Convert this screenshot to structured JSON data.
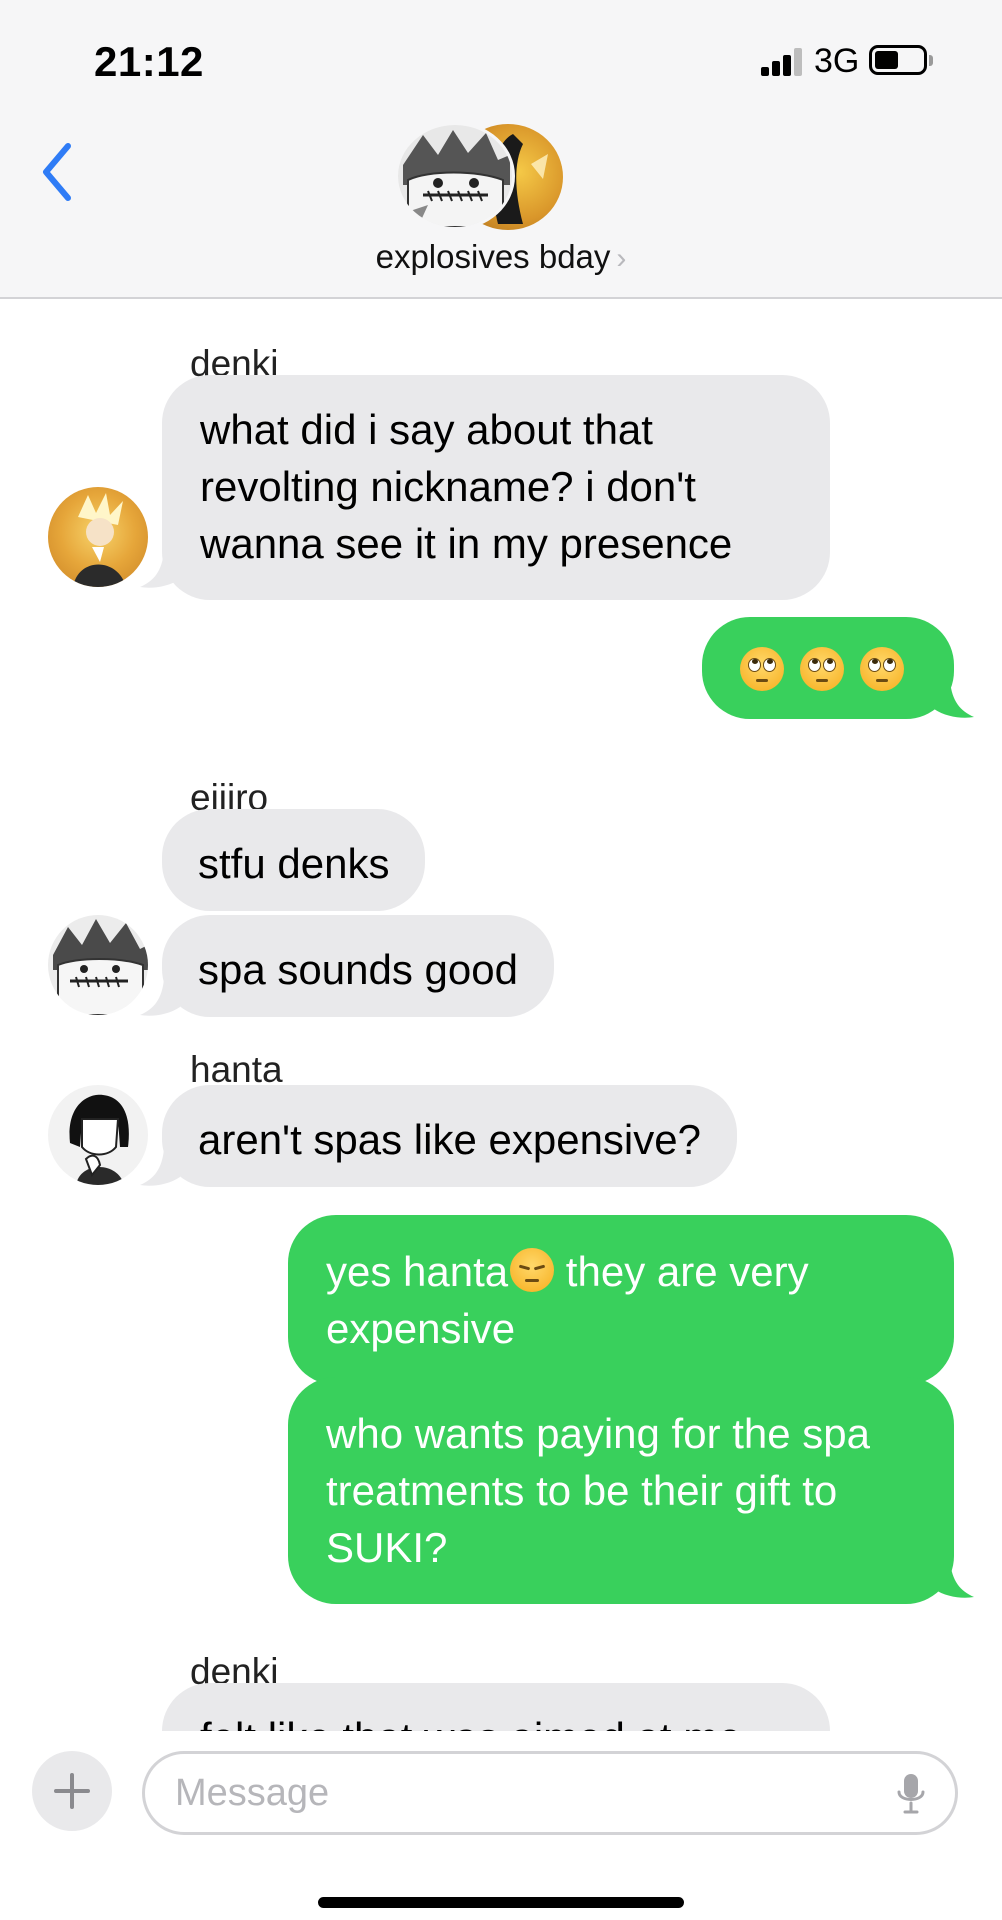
{
  "status_bar": {
    "time": "21:12",
    "network": "3G"
  },
  "header": {
    "group_name": "explosives bday",
    "chevron": "›"
  },
  "thread": {
    "m1_sender": "denki",
    "m1_text": "what did i say about that revolting nickname? i don't wanna see it in my presence",
    "m2_emoji": "face-with-rolling-eyes-icon x3",
    "m3_sender": "eijiro",
    "m3_text": "stfu denks",
    "m4_text": "spa sounds good",
    "m5_sender": "hanta",
    "m5_text": "aren't spas like expensive?",
    "m6_text_a": "yes hanta",
    "m6_text_b": "  they are very expensive",
    "m7_text": "who wants paying for the spa treatments to be their gift to SUKI?",
    "m8_sender": "denki",
    "m8_text": "felt like that was aimed at me"
  },
  "compose": {
    "placeholder": "Message"
  },
  "colors": {
    "outgoing_bubble": "#39d05c",
    "incoming_bubble": "#e9e9eb",
    "ios_blue": "#2f7cf6",
    "header_bg": "#f6f6f7"
  }
}
